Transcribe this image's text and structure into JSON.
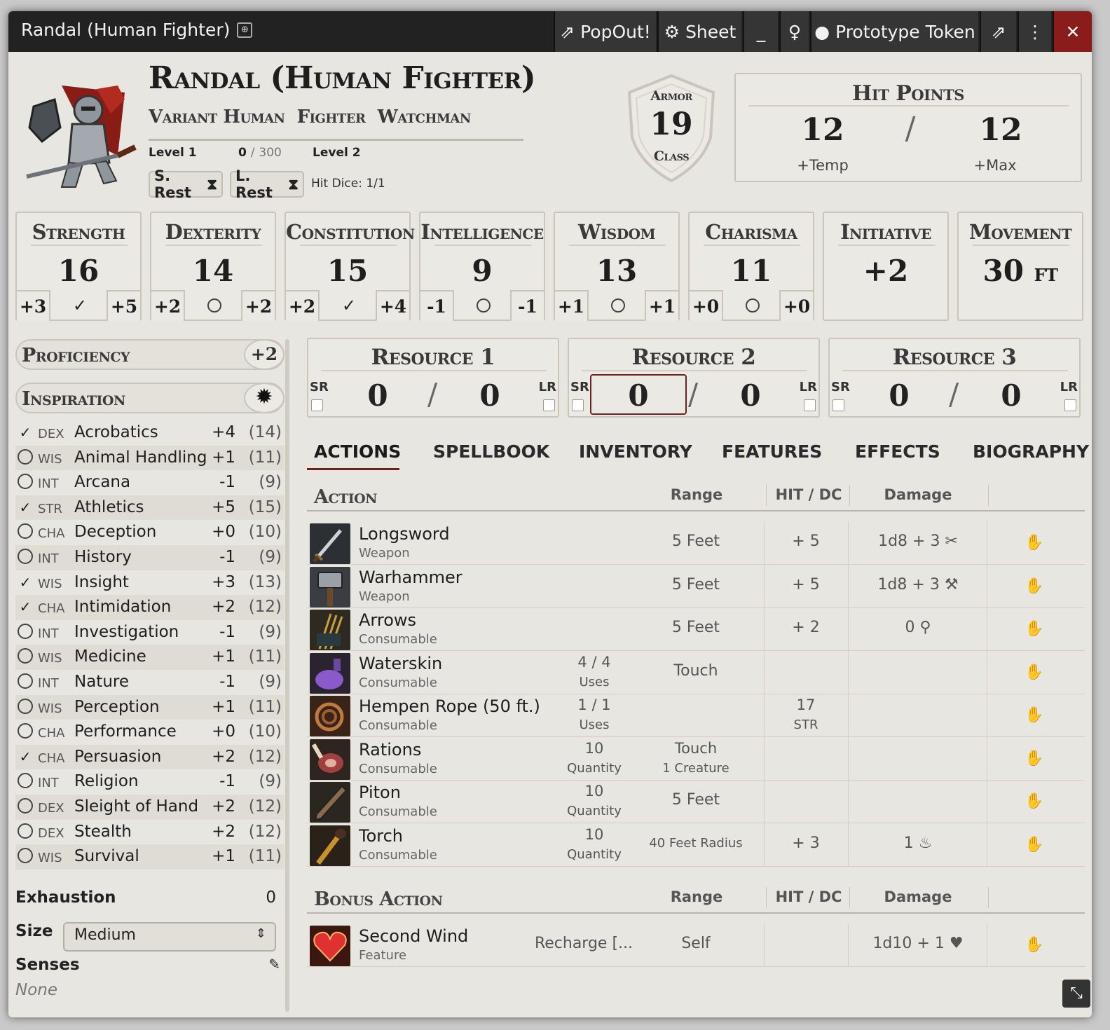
{
  "window": {
    "title": "Randal (Human Fighter)",
    "buttons": {
      "popout": "PopOut!",
      "sheet": "Sheet",
      "minimize": "_",
      "token": "Prototype Token"
    }
  },
  "header": {
    "name": "Randal (Human Fighter)",
    "subtitle": [
      "Variant Human",
      "Fighter",
      "Watchman"
    ],
    "level_current": "Level 1",
    "xp_current": "0",
    "xp_sep": "/",
    "xp_next": "300",
    "level_next": "Level 2",
    "short_rest": "S. Rest",
    "long_rest": "L. Rest",
    "hit_dice": "Hit Dice: 1/1"
  },
  "armor": {
    "label_top": "Armor",
    "value": "19",
    "label_bottom": "Class"
  },
  "hit_points": {
    "title": "Hit Points",
    "current": "12",
    "sep": "/",
    "max": "12",
    "temp_label": "+Temp",
    "max_label": "+Max"
  },
  "abilities": [
    {
      "name": "Strength",
      "score": "16",
      "mod": "+3",
      "save": "+5",
      "proficient": true
    },
    {
      "name": "Dexterity",
      "score": "14",
      "mod": "+2",
      "save": "+2",
      "proficient": false
    },
    {
      "name": "Constitution",
      "score": "15",
      "mod": "+2",
      "save": "+4",
      "proficient": true
    },
    {
      "name": "Intelligence",
      "score": "9",
      "mod": "-1",
      "save": "-1",
      "proficient": false
    },
    {
      "name": "Wisdom",
      "score": "13",
      "mod": "+1",
      "save": "+1",
      "proficient": false
    },
    {
      "name": "Charisma",
      "score": "11",
      "mod": "+0",
      "save": "+0",
      "proficient": false
    }
  ],
  "initiative": {
    "name": "Initiative",
    "value": "+2"
  },
  "movement": {
    "name": "Movement",
    "value": "30",
    "unit": "ft"
  },
  "proficiency": {
    "label": "Proficiency",
    "value": "+2"
  },
  "inspiration": {
    "label": "Inspiration"
  },
  "skills": [
    {
      "prof": true,
      "ab": "DEX",
      "name": "Acrobatics",
      "mod": "+4",
      "passive": "(14)"
    },
    {
      "prof": false,
      "ab": "WIS",
      "name": "Animal Handling",
      "mod": "+1",
      "passive": "(11)"
    },
    {
      "prof": false,
      "ab": "INT",
      "name": "Arcana",
      "mod": "-1",
      "passive": "(9)"
    },
    {
      "prof": true,
      "ab": "STR",
      "name": "Athletics",
      "mod": "+5",
      "passive": "(15)"
    },
    {
      "prof": false,
      "ab": "CHA",
      "name": "Deception",
      "mod": "+0",
      "passive": "(10)"
    },
    {
      "prof": false,
      "ab": "INT",
      "name": "History",
      "mod": "-1",
      "passive": "(9)"
    },
    {
      "prof": true,
      "ab": "WIS",
      "name": "Insight",
      "mod": "+3",
      "passive": "(13)"
    },
    {
      "prof": true,
      "ab": "CHA",
      "name": "Intimidation",
      "mod": "+2",
      "passive": "(12)"
    },
    {
      "prof": false,
      "ab": "INT",
      "name": "Investigation",
      "mod": "-1",
      "passive": "(9)"
    },
    {
      "prof": false,
      "ab": "WIS",
      "name": "Medicine",
      "mod": "+1",
      "passive": "(11)"
    },
    {
      "prof": false,
      "ab": "INT",
      "name": "Nature",
      "mod": "-1",
      "passive": "(9)"
    },
    {
      "prof": false,
      "ab": "WIS",
      "name": "Perception",
      "mod": "+1",
      "passive": "(11)"
    },
    {
      "prof": false,
      "ab": "CHA",
      "name": "Performance",
      "mod": "+0",
      "passive": "(10)"
    },
    {
      "prof": true,
      "ab": "CHA",
      "name": "Persuasion",
      "mod": "+2",
      "passive": "(12)"
    },
    {
      "prof": false,
      "ab": "INT",
      "name": "Religion",
      "mod": "-1",
      "passive": "(9)"
    },
    {
      "prof": false,
      "ab": "DEX",
      "name": "Sleight of Hand",
      "mod": "+2",
      "passive": "(12)"
    },
    {
      "prof": false,
      "ab": "DEX",
      "name": "Stealth",
      "mod": "+2",
      "passive": "(12)"
    },
    {
      "prof": false,
      "ab": "WIS",
      "name": "Survival",
      "mod": "+1",
      "passive": "(11)"
    }
  ],
  "exhaustion": {
    "label": "Exhaustion",
    "value": "0"
  },
  "size": {
    "label": "Size",
    "value": "Medium"
  },
  "senses": {
    "label": "Senses",
    "value": "None"
  },
  "resources": [
    {
      "title": "Resource 1",
      "sr": "SR",
      "lr": "LR",
      "value": "0",
      "max": "0",
      "sep": "/"
    },
    {
      "title": "Resource 2",
      "sr": "SR",
      "lr": "LR",
      "value": "0",
      "max": "0",
      "sep": "/"
    },
    {
      "title": "Resource 3",
      "sr": "SR",
      "lr": "LR",
      "value": "0",
      "max": "0",
      "sep": "/"
    }
  ],
  "tabs": [
    "ACTIONS",
    "SPELLBOOK",
    "INVENTORY",
    "FEATURES",
    "EFFECTS",
    "BIOGRAPHY"
  ],
  "active_tab": "ACTIONS",
  "action_header": {
    "title": "Action",
    "range": "Range",
    "hit": "HIT / DC",
    "damage": "Damage"
  },
  "actions": [
    {
      "name": "Longsword",
      "type": "Weapon",
      "uses": "",
      "uses_label": "",
      "range": "5 Feet",
      "range2": "",
      "hit": "+ 5",
      "hit2": "",
      "damage": "1d8 + 3",
      "dmg_icon": "slashing-icon"
    },
    {
      "name": "Warhammer",
      "type": "Weapon",
      "uses": "",
      "uses_label": "",
      "range": "5 Feet",
      "range2": "",
      "hit": "+ 5",
      "hit2": "",
      "damage": "1d8 + 3",
      "dmg_icon": "bludgeoning-icon"
    },
    {
      "name": "Arrows",
      "type": "Consumable",
      "uses": "",
      "uses_label": "",
      "range": "5 Feet",
      "range2": "",
      "hit": "+ 2",
      "hit2": "",
      "damage": "0",
      "dmg_icon": "piercing-icon"
    },
    {
      "name": "Waterskin",
      "type": "Consumable",
      "uses": "4 / 4",
      "uses_label": "Uses",
      "range": "Touch",
      "range2": "",
      "hit": "",
      "hit2": "",
      "damage": "",
      "dmg_icon": ""
    },
    {
      "name": "Hempen Rope (50 ft.)",
      "type": "Consumable",
      "uses": "1 / 1",
      "uses_label": "Uses",
      "range": "",
      "range2": "",
      "hit": "17",
      "hit2": "STR",
      "damage": "",
      "dmg_icon": ""
    },
    {
      "name": "Rations",
      "type": "Consumable",
      "uses": "10",
      "uses_label": "Quantity",
      "range": "Touch",
      "range2": "1 Creature",
      "hit": "",
      "hit2": "",
      "damage": "",
      "dmg_icon": ""
    },
    {
      "name": "Piton",
      "type": "Consumable",
      "uses": "10",
      "uses_label": "Quantity",
      "range": "5 Feet",
      "range2": "",
      "hit": "",
      "hit2": "",
      "damage": "",
      "dmg_icon": ""
    },
    {
      "name": "Torch",
      "type": "Consumable",
      "uses": "10",
      "uses_label": "Quantity",
      "range": "40 Feet Radius",
      "range2": "",
      "hit": "+ 3",
      "hit2": "",
      "damage": "1",
      "dmg_icon": "fire-icon"
    }
  ],
  "bonus_header": {
    "title": "Bonus Action",
    "range": "Range",
    "hit": "HIT / DC",
    "damage": "Damage"
  },
  "bonus_actions": [
    {
      "name": "Second Wind",
      "type": "Feature",
      "uses": "Recharge [...",
      "range": "Self",
      "damage": "1d10 + 1",
      "dmg_icon": "heart-icon"
    }
  ],
  "colors": {
    "accent": "#6b2222",
    "titlebar": "#222222",
    "close": "#8b1c1c",
    "parchment": "#e9e7e2"
  }
}
